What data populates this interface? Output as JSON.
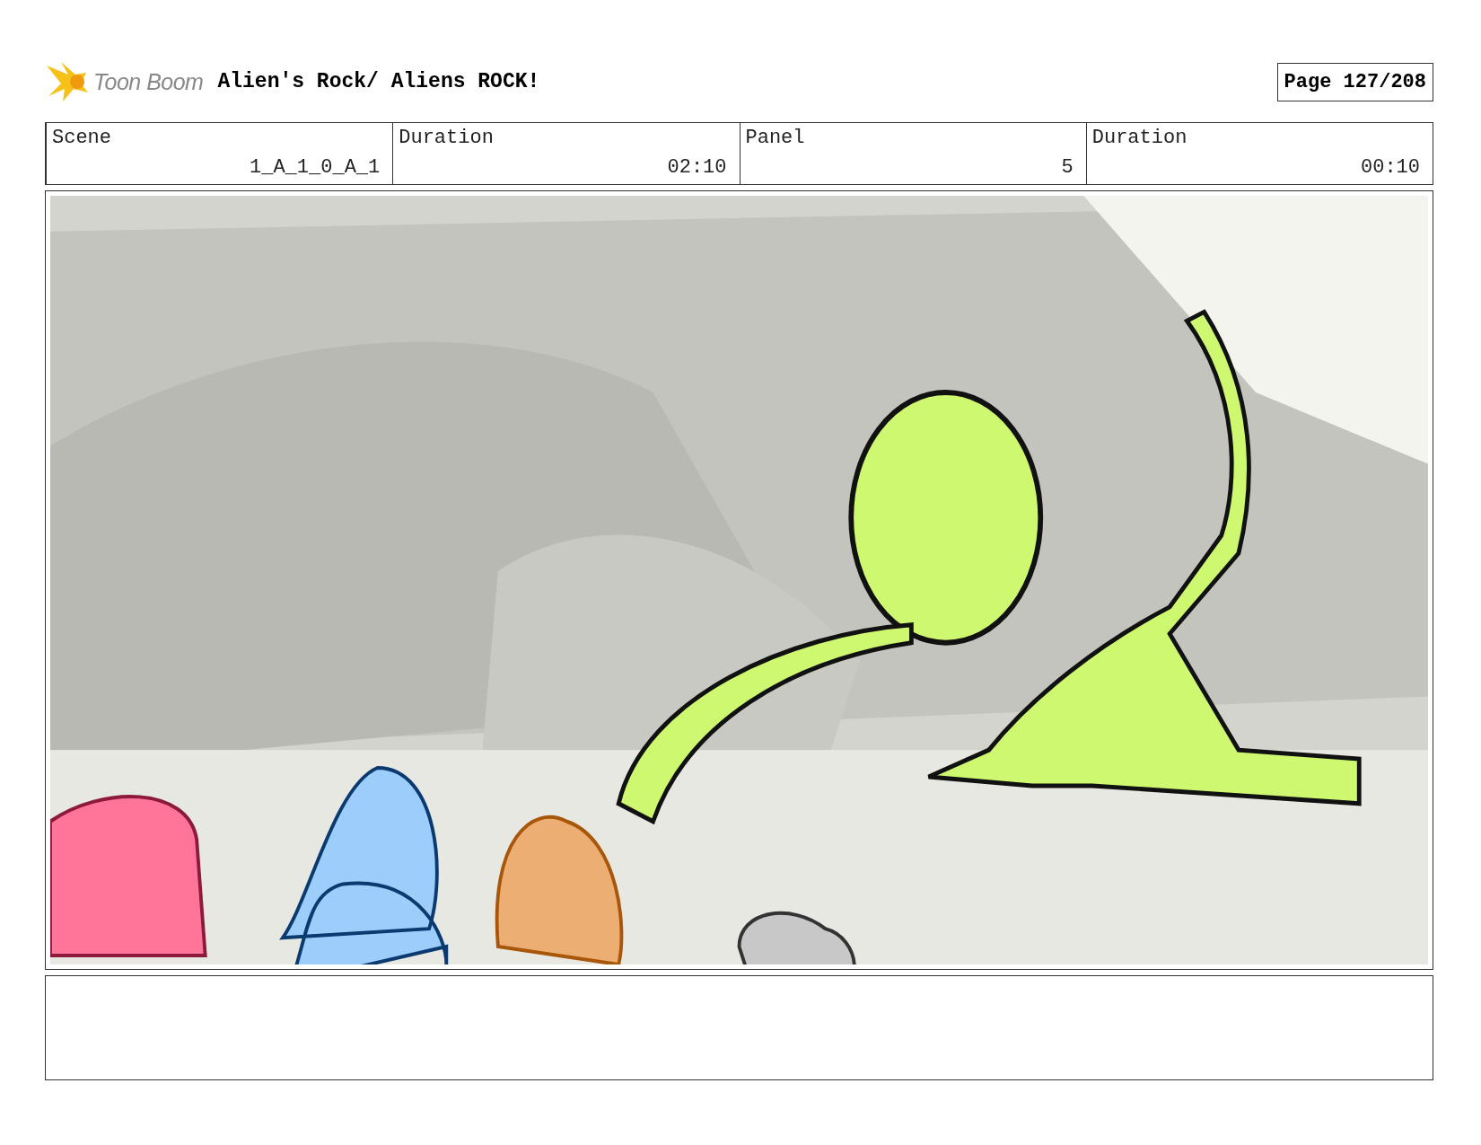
{
  "header": {
    "logo_text": "Toon Boom",
    "title": "Alien's Rock/ Aliens ROCK!",
    "page": "Page 127/208"
  },
  "fields": [
    {
      "label": "Scene",
      "value": "1_A_1_0_A_1"
    },
    {
      "label": "Duration",
      "value": "02:10"
    },
    {
      "label": "Panel",
      "value": "5"
    },
    {
      "label": "Duration",
      "value": "00:10"
    }
  ]
}
